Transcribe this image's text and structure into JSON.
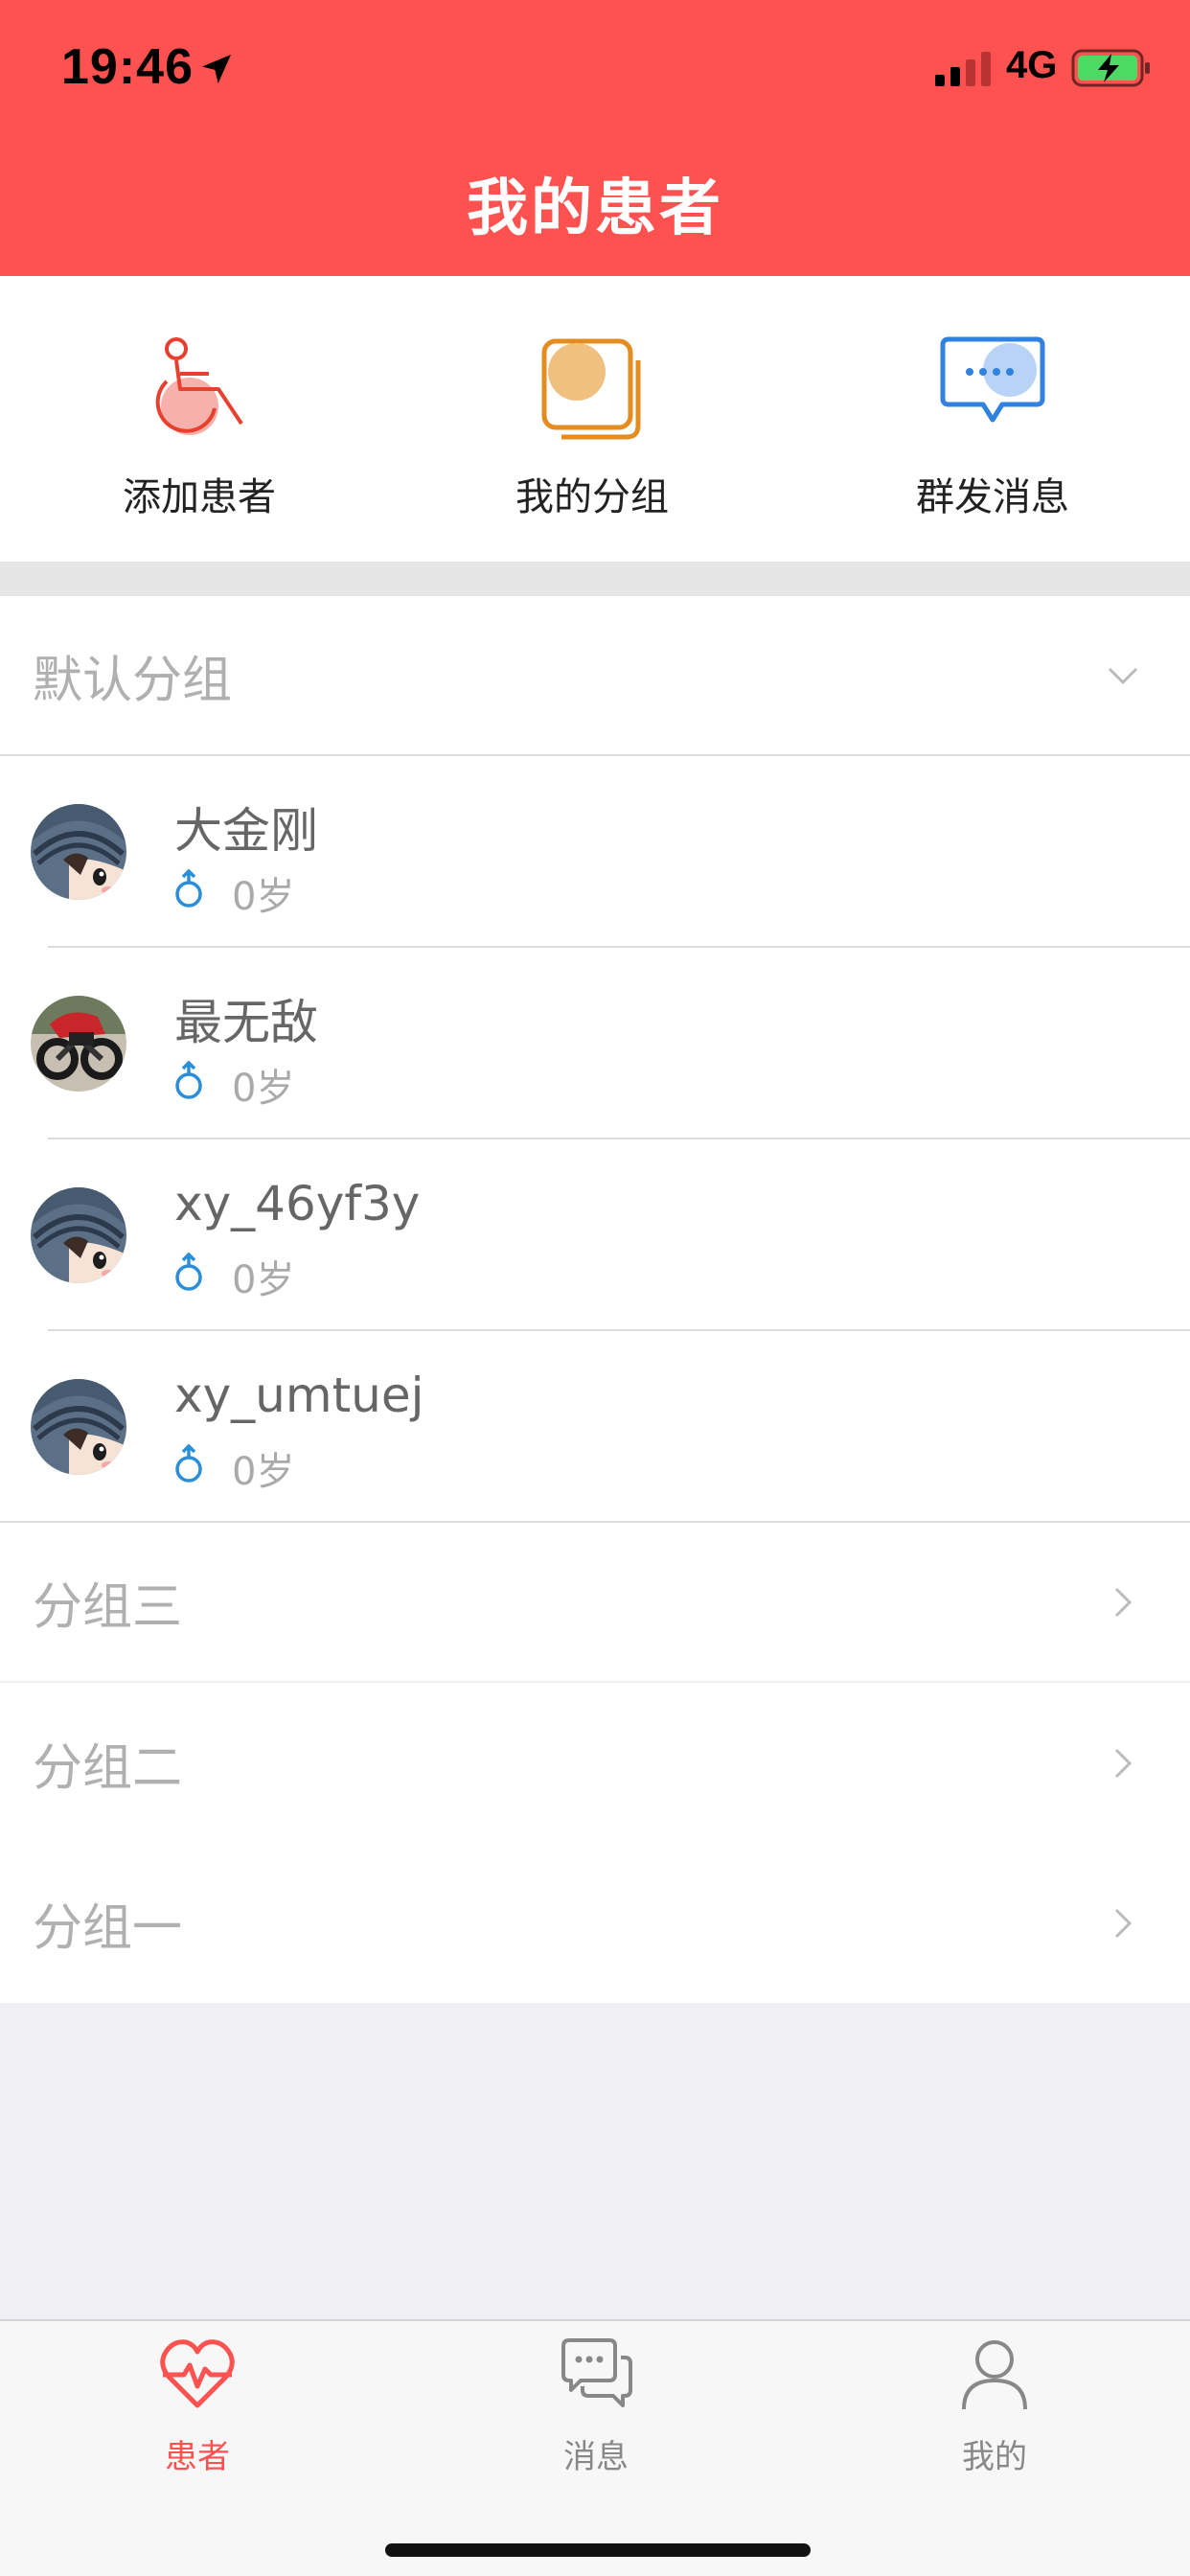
{
  "status_bar": {
    "time": "19:46",
    "network": "4G"
  },
  "header": {
    "title": "我的患者",
    "background": "#fe5250"
  },
  "quick_actions": [
    {
      "label": "添加患者",
      "icon": "wheelchair-icon"
    },
    {
      "label": "我的分组",
      "icon": "group-folder-icon"
    },
    {
      "label": "群发消息",
      "icon": "message-bubble-icon"
    }
  ],
  "groups": {
    "default": {
      "name": "默认分组",
      "expanded": true,
      "patients": [
        {
          "name": "大金刚",
          "gender": "male-icon",
          "age": "0岁",
          "avatar": "cartoon-avatar"
        },
        {
          "name": "最无敌",
          "gender": "male-icon",
          "age": "0岁",
          "avatar": "motorcycle-photo-avatar"
        },
        {
          "name": "xy_46yf3y",
          "gender": "male-icon",
          "age": "0岁",
          "avatar": "cartoon-avatar"
        },
        {
          "name": "xy_umtuej",
          "gender": "male-icon",
          "age": "0岁",
          "avatar": "cartoon-avatar"
        }
      ]
    },
    "collapsed": [
      {
        "name": "分组三"
      },
      {
        "name": "分组二"
      },
      {
        "name": "分组一"
      }
    ]
  },
  "tabbar": {
    "items": [
      {
        "label": "患者",
        "icon": "heart-pulse-icon",
        "active": true
      },
      {
        "label": "消息",
        "icon": "chat-bubbles-icon",
        "active": false
      },
      {
        "label": "我的",
        "icon": "person-icon",
        "active": false
      }
    ],
    "active_color": "#fe5250"
  }
}
